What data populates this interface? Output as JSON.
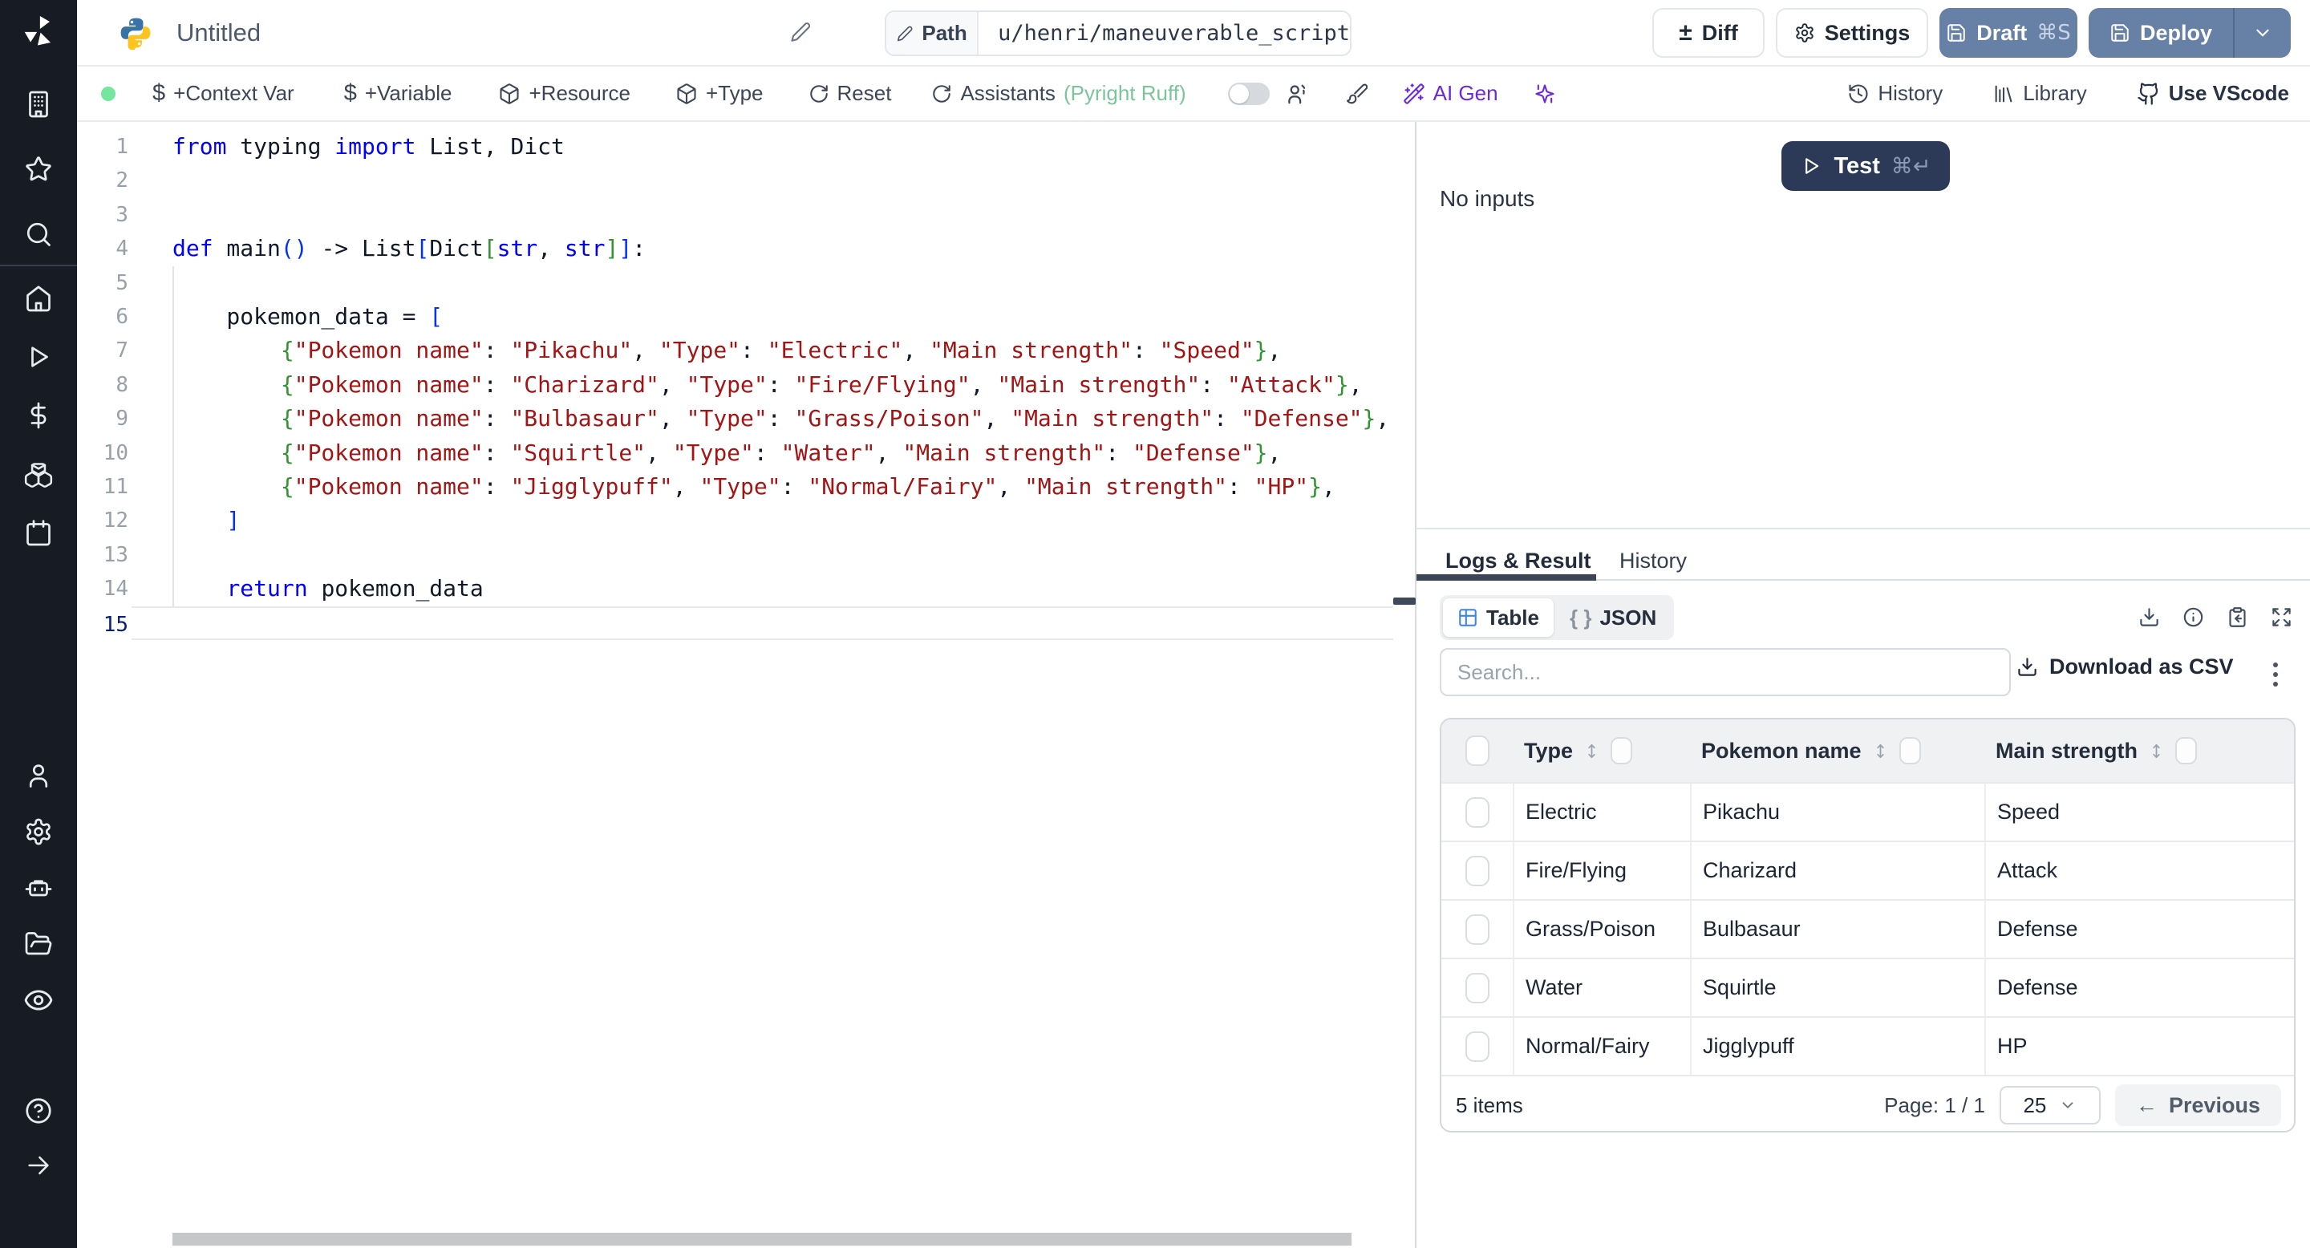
{
  "topbar": {
    "title": "Untitled",
    "path_label": "Path",
    "path_value": "u/henri/maneuverable_script",
    "diff": "Diff",
    "settings": "Settings",
    "draft": "Draft",
    "draft_shortcut": "⌘S",
    "deploy": "Deploy"
  },
  "toolbar": {
    "add_context_var": "+Context Var",
    "add_variable": "+Variable",
    "add_resource": "+Resource",
    "add_type": "+Type",
    "reset": "Reset",
    "assistants": "Assistants",
    "assistants_status": "(Pyright Ruff)",
    "ai_gen": "AI Gen",
    "history": "History",
    "library": "Library",
    "use_vscode": "Use VScode"
  },
  "sidebar_icons": [
    "windmill-logo",
    "building",
    "star",
    "search",
    "home",
    "play",
    "dollar",
    "cubes",
    "calendar",
    "user",
    "gear",
    "robot",
    "folder",
    "eye",
    "help",
    "arrow-right"
  ],
  "editor": {
    "language": "python",
    "lines": [
      {
        "n": 1,
        "seg": [
          [
            "from",
            "k"
          ],
          [
            " typing ",
            "t"
          ],
          [
            "import",
            "k"
          ],
          [
            " List, Dict",
            "t"
          ]
        ]
      },
      {
        "n": 2,
        "seg": []
      },
      {
        "n": 3,
        "seg": []
      },
      {
        "n": 4,
        "seg": [
          [
            "def",
            "k"
          ],
          [
            " main",
            "t"
          ],
          [
            "()",
            "b1"
          ],
          [
            " -> List",
            "t"
          ],
          [
            "[",
            "b1"
          ],
          [
            "Dict",
            "t"
          ],
          [
            "[",
            "b2"
          ],
          [
            "str",
            "k"
          ],
          [
            ", ",
            "t"
          ],
          [
            "str",
            "k"
          ],
          [
            "]",
            "b2"
          ],
          [
            "]",
            "b1"
          ],
          [
            ":",
            "t"
          ]
        ]
      },
      {
        "n": 5,
        "seg": []
      },
      {
        "n": 6,
        "seg": [
          [
            "    pokemon_data = ",
            "t"
          ],
          [
            "[",
            "b1"
          ]
        ]
      },
      {
        "n": 7,
        "seg": [
          [
            "        ",
            "t"
          ],
          [
            "{",
            "b2"
          ],
          [
            "\"Pokemon name\"",
            "s"
          ],
          [
            ": ",
            "t"
          ],
          [
            "\"Pikachu\"",
            "s"
          ],
          [
            ", ",
            "t"
          ],
          [
            "\"Type\"",
            "s"
          ],
          [
            ": ",
            "t"
          ],
          [
            "\"Electric\"",
            "s"
          ],
          [
            ", ",
            "t"
          ],
          [
            "\"Main strength\"",
            "s"
          ],
          [
            ": ",
            "t"
          ],
          [
            "\"Speed\"",
            "s"
          ],
          [
            "}",
            "b2"
          ],
          [
            ",",
            "t"
          ]
        ]
      },
      {
        "n": 8,
        "seg": [
          [
            "        ",
            "t"
          ],
          [
            "{",
            "b2"
          ],
          [
            "\"Pokemon name\"",
            "s"
          ],
          [
            ": ",
            "t"
          ],
          [
            "\"Charizard\"",
            "s"
          ],
          [
            ", ",
            "t"
          ],
          [
            "\"Type\"",
            "s"
          ],
          [
            ": ",
            "t"
          ],
          [
            "\"Fire/Flying\"",
            "s"
          ],
          [
            ", ",
            "t"
          ],
          [
            "\"Main strength\"",
            "s"
          ],
          [
            ": ",
            "t"
          ],
          [
            "\"Attack\"",
            "s"
          ],
          [
            "}",
            "b2"
          ],
          [
            ",",
            "t"
          ]
        ]
      },
      {
        "n": 9,
        "seg": [
          [
            "        ",
            "t"
          ],
          [
            "{",
            "b2"
          ],
          [
            "\"Pokemon name\"",
            "s"
          ],
          [
            ": ",
            "t"
          ],
          [
            "\"Bulbasaur\"",
            "s"
          ],
          [
            ", ",
            "t"
          ],
          [
            "\"Type\"",
            "s"
          ],
          [
            ": ",
            "t"
          ],
          [
            "\"Grass/Poison\"",
            "s"
          ],
          [
            ", ",
            "t"
          ],
          [
            "\"Main strength\"",
            "s"
          ],
          [
            ": ",
            "t"
          ],
          [
            "\"Defense\"",
            "s"
          ],
          [
            "}",
            "b2"
          ],
          [
            ",",
            "t"
          ]
        ]
      },
      {
        "n": 10,
        "seg": [
          [
            "        ",
            "t"
          ],
          [
            "{",
            "b2"
          ],
          [
            "\"Pokemon name\"",
            "s"
          ],
          [
            ": ",
            "t"
          ],
          [
            "\"Squirtle\"",
            "s"
          ],
          [
            ", ",
            "t"
          ],
          [
            "\"Type\"",
            "s"
          ],
          [
            ": ",
            "t"
          ],
          [
            "\"Water\"",
            "s"
          ],
          [
            ", ",
            "t"
          ],
          [
            "\"Main strength\"",
            "s"
          ],
          [
            ": ",
            "t"
          ],
          [
            "\"Defense\"",
            "s"
          ],
          [
            "}",
            "b2"
          ],
          [
            ",",
            "t"
          ]
        ]
      },
      {
        "n": 11,
        "seg": [
          [
            "        ",
            "t"
          ],
          [
            "{",
            "b2"
          ],
          [
            "\"Pokemon name\"",
            "s"
          ],
          [
            ": ",
            "t"
          ],
          [
            "\"Jigglypuff\"",
            "s"
          ],
          [
            ", ",
            "t"
          ],
          [
            "\"Type\"",
            "s"
          ],
          [
            ": ",
            "t"
          ],
          [
            "\"Normal/Fairy\"",
            "s"
          ],
          [
            ", ",
            "t"
          ],
          [
            "\"Main strength\"",
            "s"
          ],
          [
            ": ",
            "t"
          ],
          [
            "\"HP\"",
            "s"
          ],
          [
            "}",
            "b2"
          ],
          [
            ",",
            "t"
          ]
        ]
      },
      {
        "n": 12,
        "seg": [
          [
            "    ",
            "t"
          ],
          [
            "]",
            "b1"
          ]
        ]
      },
      {
        "n": 13,
        "seg": []
      },
      {
        "n": 14,
        "seg": [
          [
            "    ",
            "t"
          ],
          [
            "return",
            "k"
          ],
          [
            " pokemon_data",
            "t"
          ]
        ]
      },
      {
        "n": 15,
        "seg": [],
        "active": true
      }
    ]
  },
  "run_panel": {
    "test": "Test",
    "test_shortcut": "⌘↵",
    "no_inputs": "No inputs"
  },
  "result_panel": {
    "tabs": [
      {
        "label": "Logs & Result",
        "active": true
      },
      {
        "label": "History",
        "active": false
      }
    ],
    "views": [
      {
        "label": "Table",
        "active": true
      },
      {
        "label": "JSON",
        "active": false
      }
    ],
    "json_glyph": "{ }",
    "search_placeholder": "Search...",
    "download_csv": "Download as CSV",
    "table": {
      "columns": [
        "Type",
        "Pokemon name",
        "Main strength"
      ],
      "rows": [
        [
          "Electric",
          "Pikachu",
          "Speed"
        ],
        [
          "Fire/Flying",
          "Charizard",
          "Attack"
        ],
        [
          "Grass/Poison",
          "Bulbasaur",
          "Defense"
        ],
        [
          "Water",
          "Squirtle",
          "Defense"
        ],
        [
          "Normal/Fairy",
          "Jigglypuff",
          "HP"
        ]
      ]
    },
    "footer": {
      "items_count": "5 items",
      "page": "Page: 1 / 1",
      "page_size": "25",
      "previous_arrow": "←",
      "previous": "Previous"
    }
  },
  "colors": {
    "primary_button": "#6780a6",
    "test_button": "#2d3a57",
    "sidebar_bg": "#171b24",
    "accent_green": "#74e69e",
    "assistants_green": "#7cc49c",
    "ai_purple": "#6d28d9",
    "code_keyword": "#0000ff",
    "code_string": "#a31515",
    "bracket_blue": "#0431fa",
    "bracket_green": "#319331"
  }
}
